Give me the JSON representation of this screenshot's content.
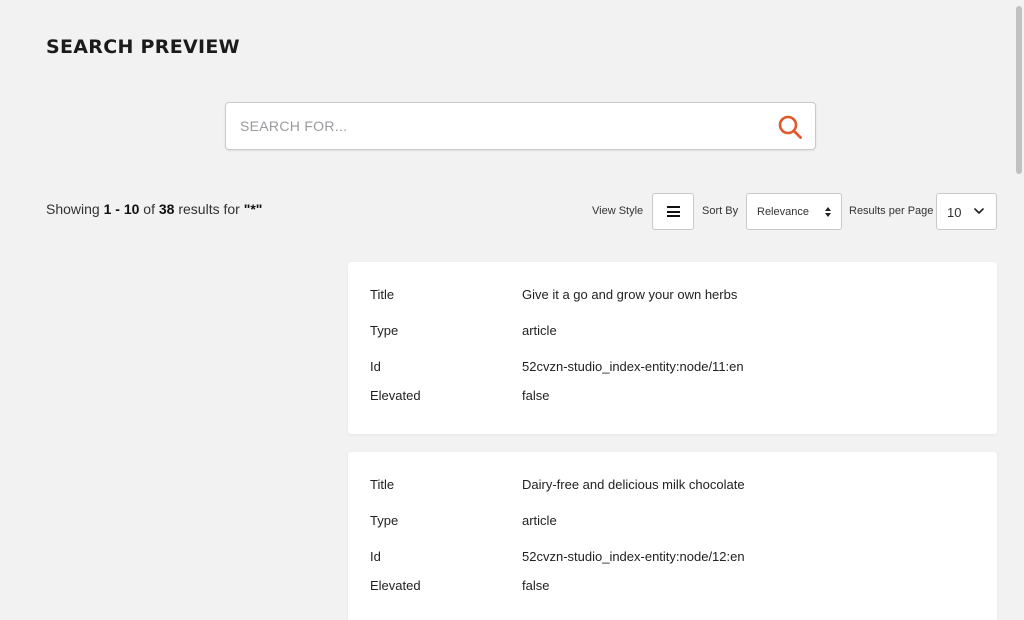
{
  "page_title": "SEARCH PREVIEW",
  "search": {
    "placeholder": "SEARCH FOR...",
    "value": "",
    "icon": "search-icon",
    "accent_color": "#e0592a"
  },
  "results_summary": {
    "prefix": "Showing ",
    "range": "1 - 10",
    "of": " of ",
    "total": "38",
    "results_for": " results for ",
    "query": "\"*\""
  },
  "controls": {
    "view_style_label": "View Style",
    "view_style_icon": "list-view-icon",
    "sort_by_label": "Sort By",
    "sort_by_value": "Relevance",
    "results_per_page_label": "Results per Page",
    "results_per_page_value": "10"
  },
  "results": [
    {
      "fields": [
        {
          "label": "Title",
          "value": "Give it a go and grow your own herbs"
        },
        {
          "label": "Type",
          "value": "article"
        },
        {
          "label": "Id",
          "value": "52cvzn-studio_index-entity:node/11:en"
        },
        {
          "label": "Elevated",
          "value": "false"
        }
      ]
    },
    {
      "fields": [
        {
          "label": "Title",
          "value": "Dairy-free and delicious milk chocolate"
        },
        {
          "label": "Type",
          "value": "article"
        },
        {
          "label": "Id",
          "value": "52cvzn-studio_index-entity:node/12:en"
        },
        {
          "label": "Elevated",
          "value": "false"
        }
      ]
    }
  ]
}
